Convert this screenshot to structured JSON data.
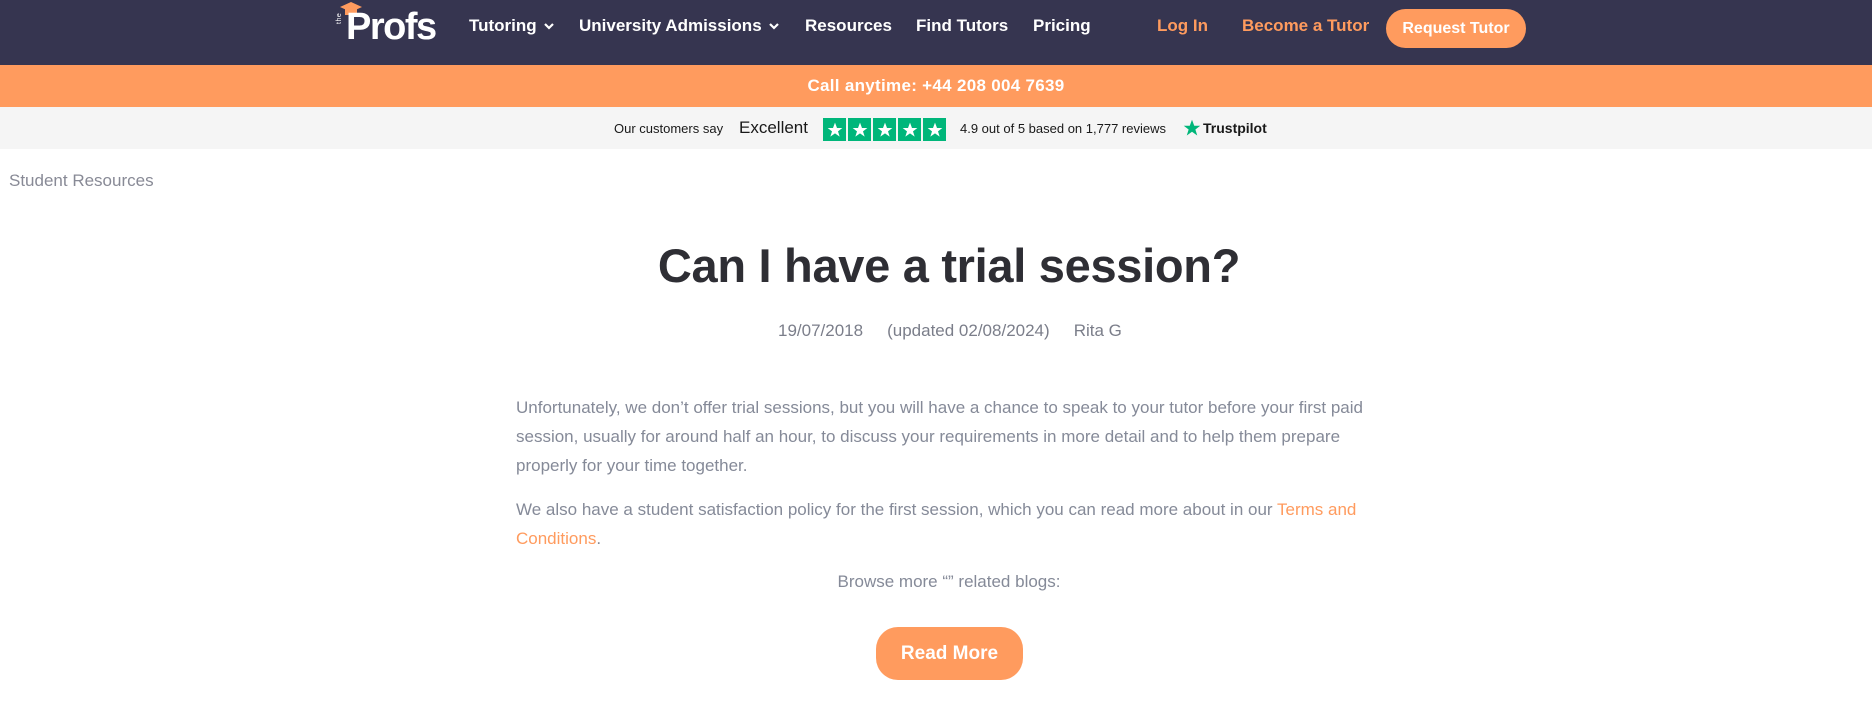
{
  "brand": {
    "prefix": "the",
    "name": "Profs",
    "accent_color": "#ff9b5e",
    "nav_bg": "#363550"
  },
  "nav": {
    "items": [
      {
        "label": "Tutoring",
        "has_dropdown": true
      },
      {
        "label": "University Admissions",
        "has_dropdown": true
      },
      {
        "label": "Resources",
        "has_dropdown": false
      },
      {
        "label": "Find Tutors",
        "has_dropdown": false
      },
      {
        "label": "Pricing",
        "has_dropdown": false
      }
    ],
    "login": "Log In",
    "become_tutor": "Become a Tutor",
    "request_tutor": "Request Tutor"
  },
  "callbar": {
    "text": "Call anytime: +44 208 004 7639"
  },
  "trustpilot": {
    "say": "Our customers say",
    "rating_word": "Excellent",
    "stars": 5,
    "score_text": "4.9 out of 5 based on 1,777 reviews",
    "brand": "Trustpilot",
    "star_color": "#00b67a"
  },
  "breadcrumb": "Student Resources",
  "article": {
    "title": "Can I have a trial session?",
    "date": "19/07/2018",
    "updated": "(updated 02/08/2024)",
    "author": "Rita G",
    "paragraph1": "Unfortunately, we don’t offer trial sessions, but you will have a chance to speak to your tutor before your first paid session, usually for around half an hour, to discuss your requirements in more detail and to help them prepare properly for your time together.",
    "paragraph2_text": "We also have a student satisfaction policy for the first session, which you can read more about in our ",
    "paragraph2_link": "Terms and Conditions",
    "paragraph2_end": ".",
    "browse": "Browse more “” related blogs:",
    "read_more": "Read More"
  }
}
